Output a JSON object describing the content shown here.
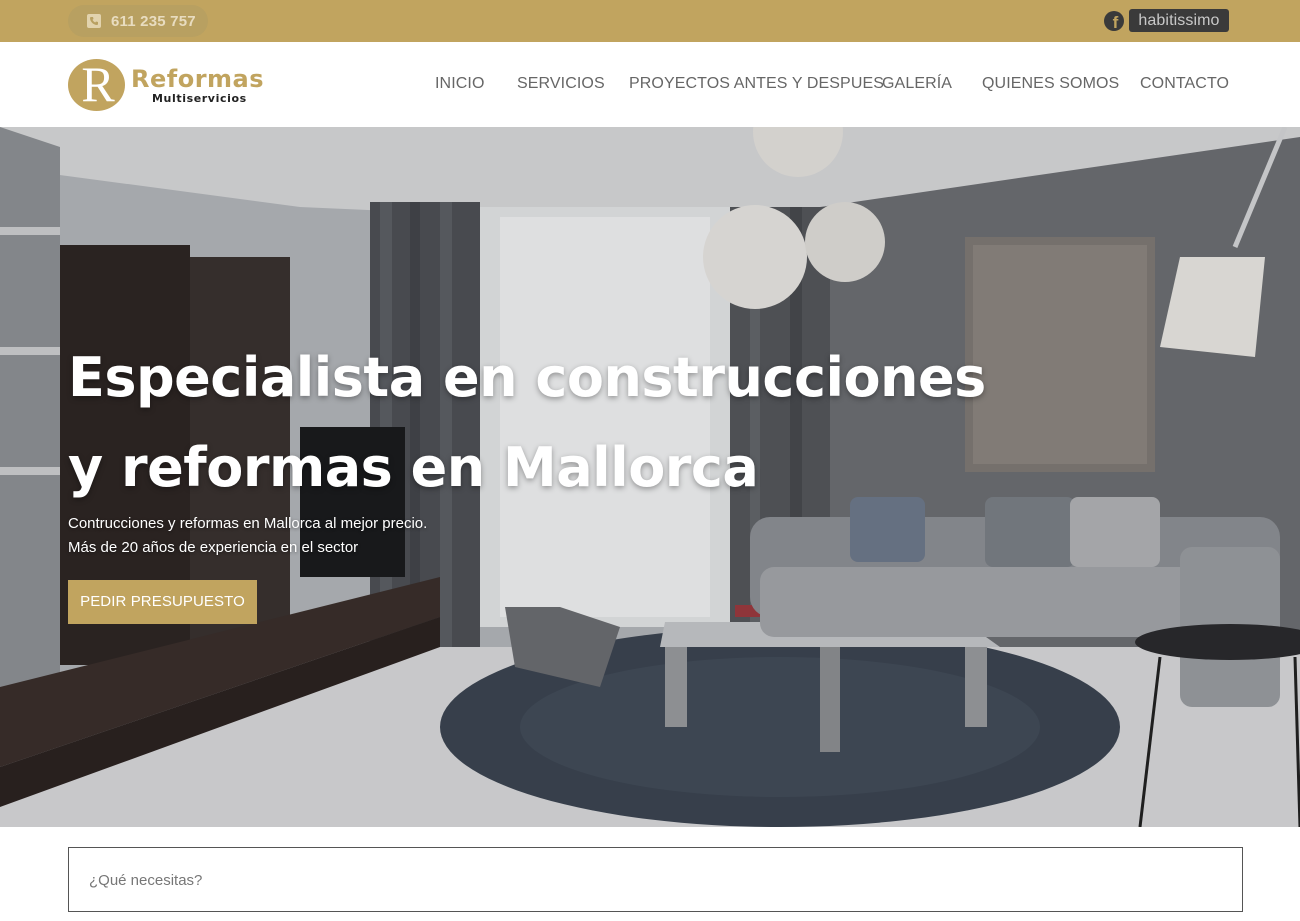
{
  "topbar": {
    "phone": "611 235 757",
    "phone_icon": "phone-icon",
    "facebook_icon": "facebook-icon",
    "habitissimo_label": "habitissimo",
    "background_color": "#c1a45f"
  },
  "header": {
    "logo": {
      "mark": "R",
      "word": "Reformas",
      "sub": "Multiservicios"
    },
    "nav": [
      {
        "label": "INICIO"
      },
      {
        "label": "SERVICIOS"
      },
      {
        "label": "PROYECTOS ANTES Y DESPUES"
      },
      {
        "label": "GALERÍA"
      },
      {
        "label": "QUIENES SOMOS"
      },
      {
        "label": "CONTACTO"
      }
    ]
  },
  "hero": {
    "title_line1": "Especialista en construcciones",
    "title_line2": "y reformas en Mallorca",
    "subtitle_line1": "Contrucciones y reformas en Mallorca al mejor precio.",
    "subtitle_line2": "Más de 20 años de experiencia en el sector",
    "cta_label": "PEDIR PRESUPUESTO",
    "accent_color": "#c1a45f"
  },
  "search": {
    "placeholder": "¿Qué necesitas?",
    "value": ""
  }
}
